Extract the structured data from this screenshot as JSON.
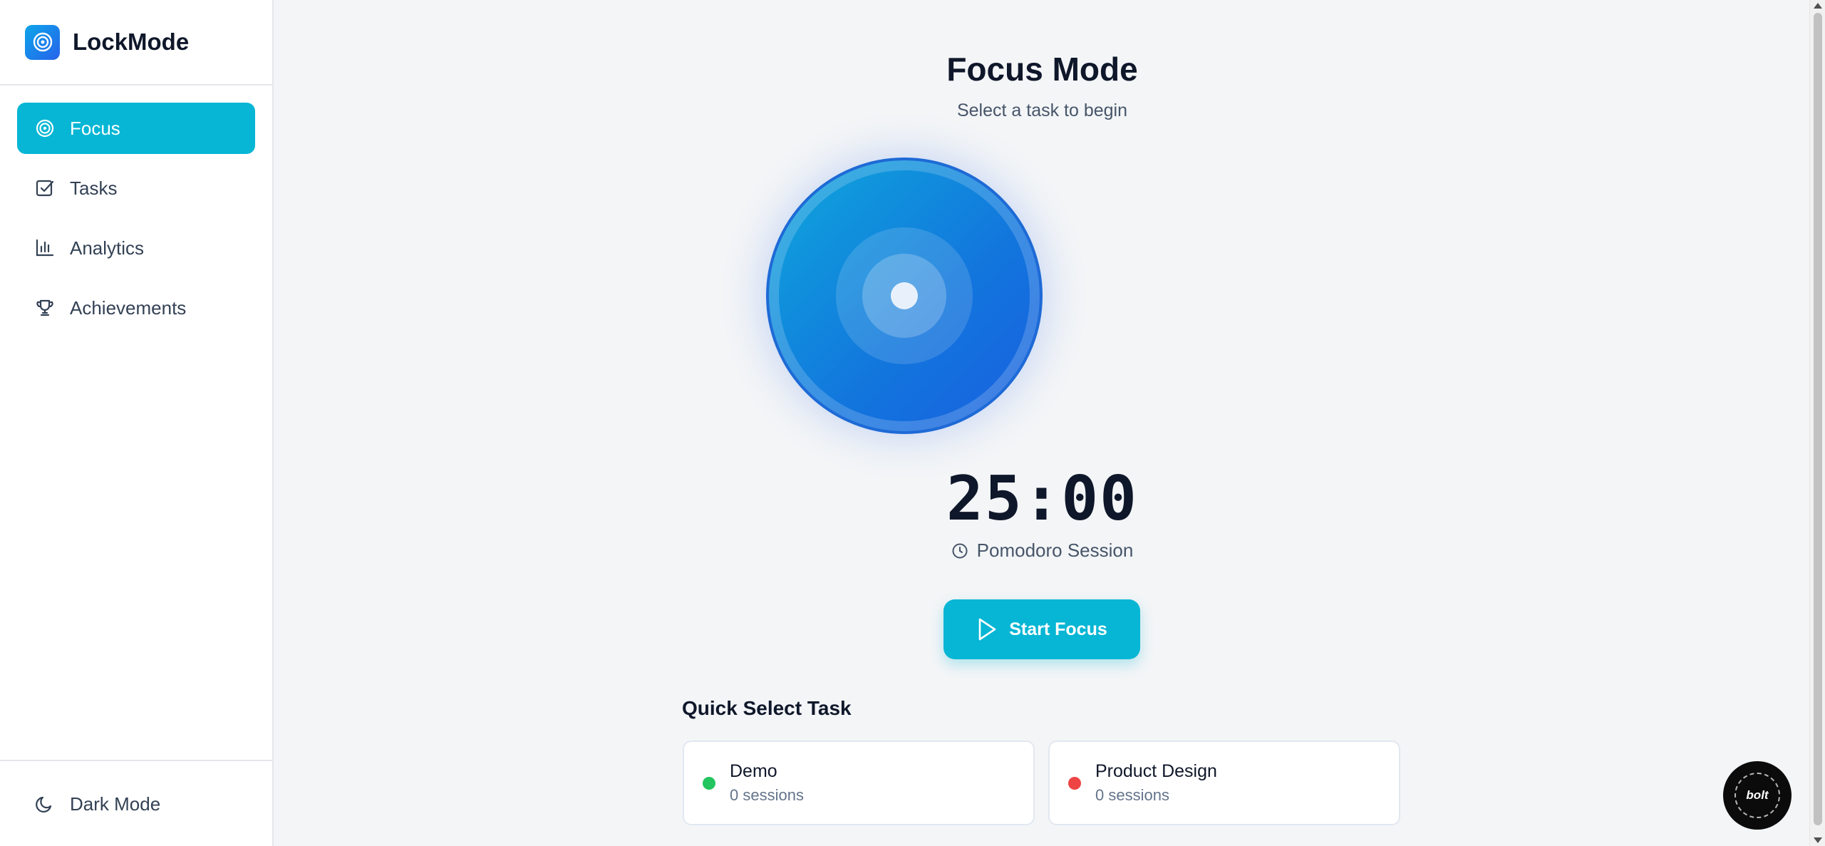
{
  "app": {
    "name": "LockMode"
  },
  "sidebar": {
    "items": [
      {
        "label": "Focus",
        "icon": "target-icon",
        "active": true
      },
      {
        "label": "Tasks",
        "icon": "checkbox-icon",
        "active": false
      },
      {
        "label": "Analytics",
        "icon": "bar-chart-icon",
        "active": false
      },
      {
        "label": "Achievements",
        "icon": "trophy-icon",
        "active": false
      }
    ],
    "footer": {
      "label": "Dark Mode",
      "icon": "moon-icon"
    }
  },
  "main": {
    "title": "Focus Mode",
    "subtitle": "Select a task to begin",
    "timer": "25:00",
    "session_label": "Pomodoro Session",
    "start_button": "Start Focus",
    "quick_select_title": "Quick Select Task",
    "tasks": [
      {
        "name": "Demo",
        "sessions": "0 sessions",
        "color": "#22c55e"
      },
      {
        "name": "Product Design",
        "sessions": "0 sessions",
        "color": "#ef4444"
      }
    ]
  },
  "badge": {
    "label": "bolt"
  },
  "colors": {
    "accent": "#06b6d4",
    "orb_start": "#0fa8dc",
    "orb_end": "#1a5fe0"
  }
}
